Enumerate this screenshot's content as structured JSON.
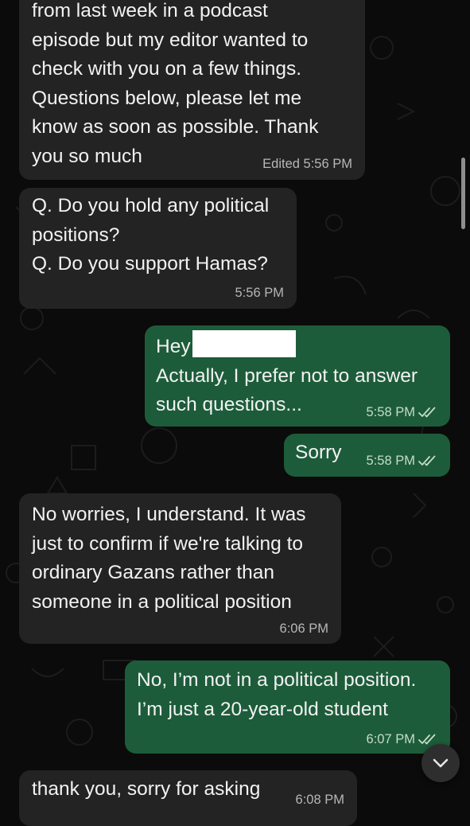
{
  "messages": [
    {
      "direction": "incoming",
      "lines": [
        "from last week in a podcast",
        "episode but my editor wanted to",
        "check with you on a few things.",
        "Questions below, please let me",
        "know as soon as possible. Thank",
        "you so much"
      ],
      "time": "Edited 5:56 PM"
    },
    {
      "direction": "incoming",
      "lines": [
        "Q. Do you hold any political",
        "positions?",
        "Q. Do you support Hamas?"
      ],
      "time": "5:56 PM"
    },
    {
      "direction": "outgoing",
      "greeting": "Hey",
      "lines": [
        "Actually, I prefer not to answer",
        "such questions..."
      ],
      "time": "5:58 PM",
      "status": "read"
    },
    {
      "direction": "outgoing",
      "lines": [
        "Sorry"
      ],
      "time": "5:58 PM",
      "status": "read"
    },
    {
      "direction": "incoming",
      "lines": [
        "No worries, I understand. It was",
        "just to confirm if we're talking to",
        "ordinary Gazans rather than",
        "someone in a political position"
      ],
      "time": "6:06 PM"
    },
    {
      "direction": "outgoing",
      "lines": [
        "No, I’m not in a political position.",
        "I’m just a 20-year-old student"
      ],
      "time": "6:07 PM",
      "status": "read"
    },
    {
      "direction": "incoming",
      "lines": [
        "thank you, sorry for asking"
      ],
      "time": "6:08 PM"
    }
  ],
  "icons": {
    "read_receipt": "double-check-icon",
    "scroll_down": "chevron-down-icon"
  },
  "colors": {
    "background": "#0b0b0b",
    "incoming_bubble": "#232323",
    "outgoing_bubble": "#1d5c3a",
    "text": "#f2f2f2"
  }
}
